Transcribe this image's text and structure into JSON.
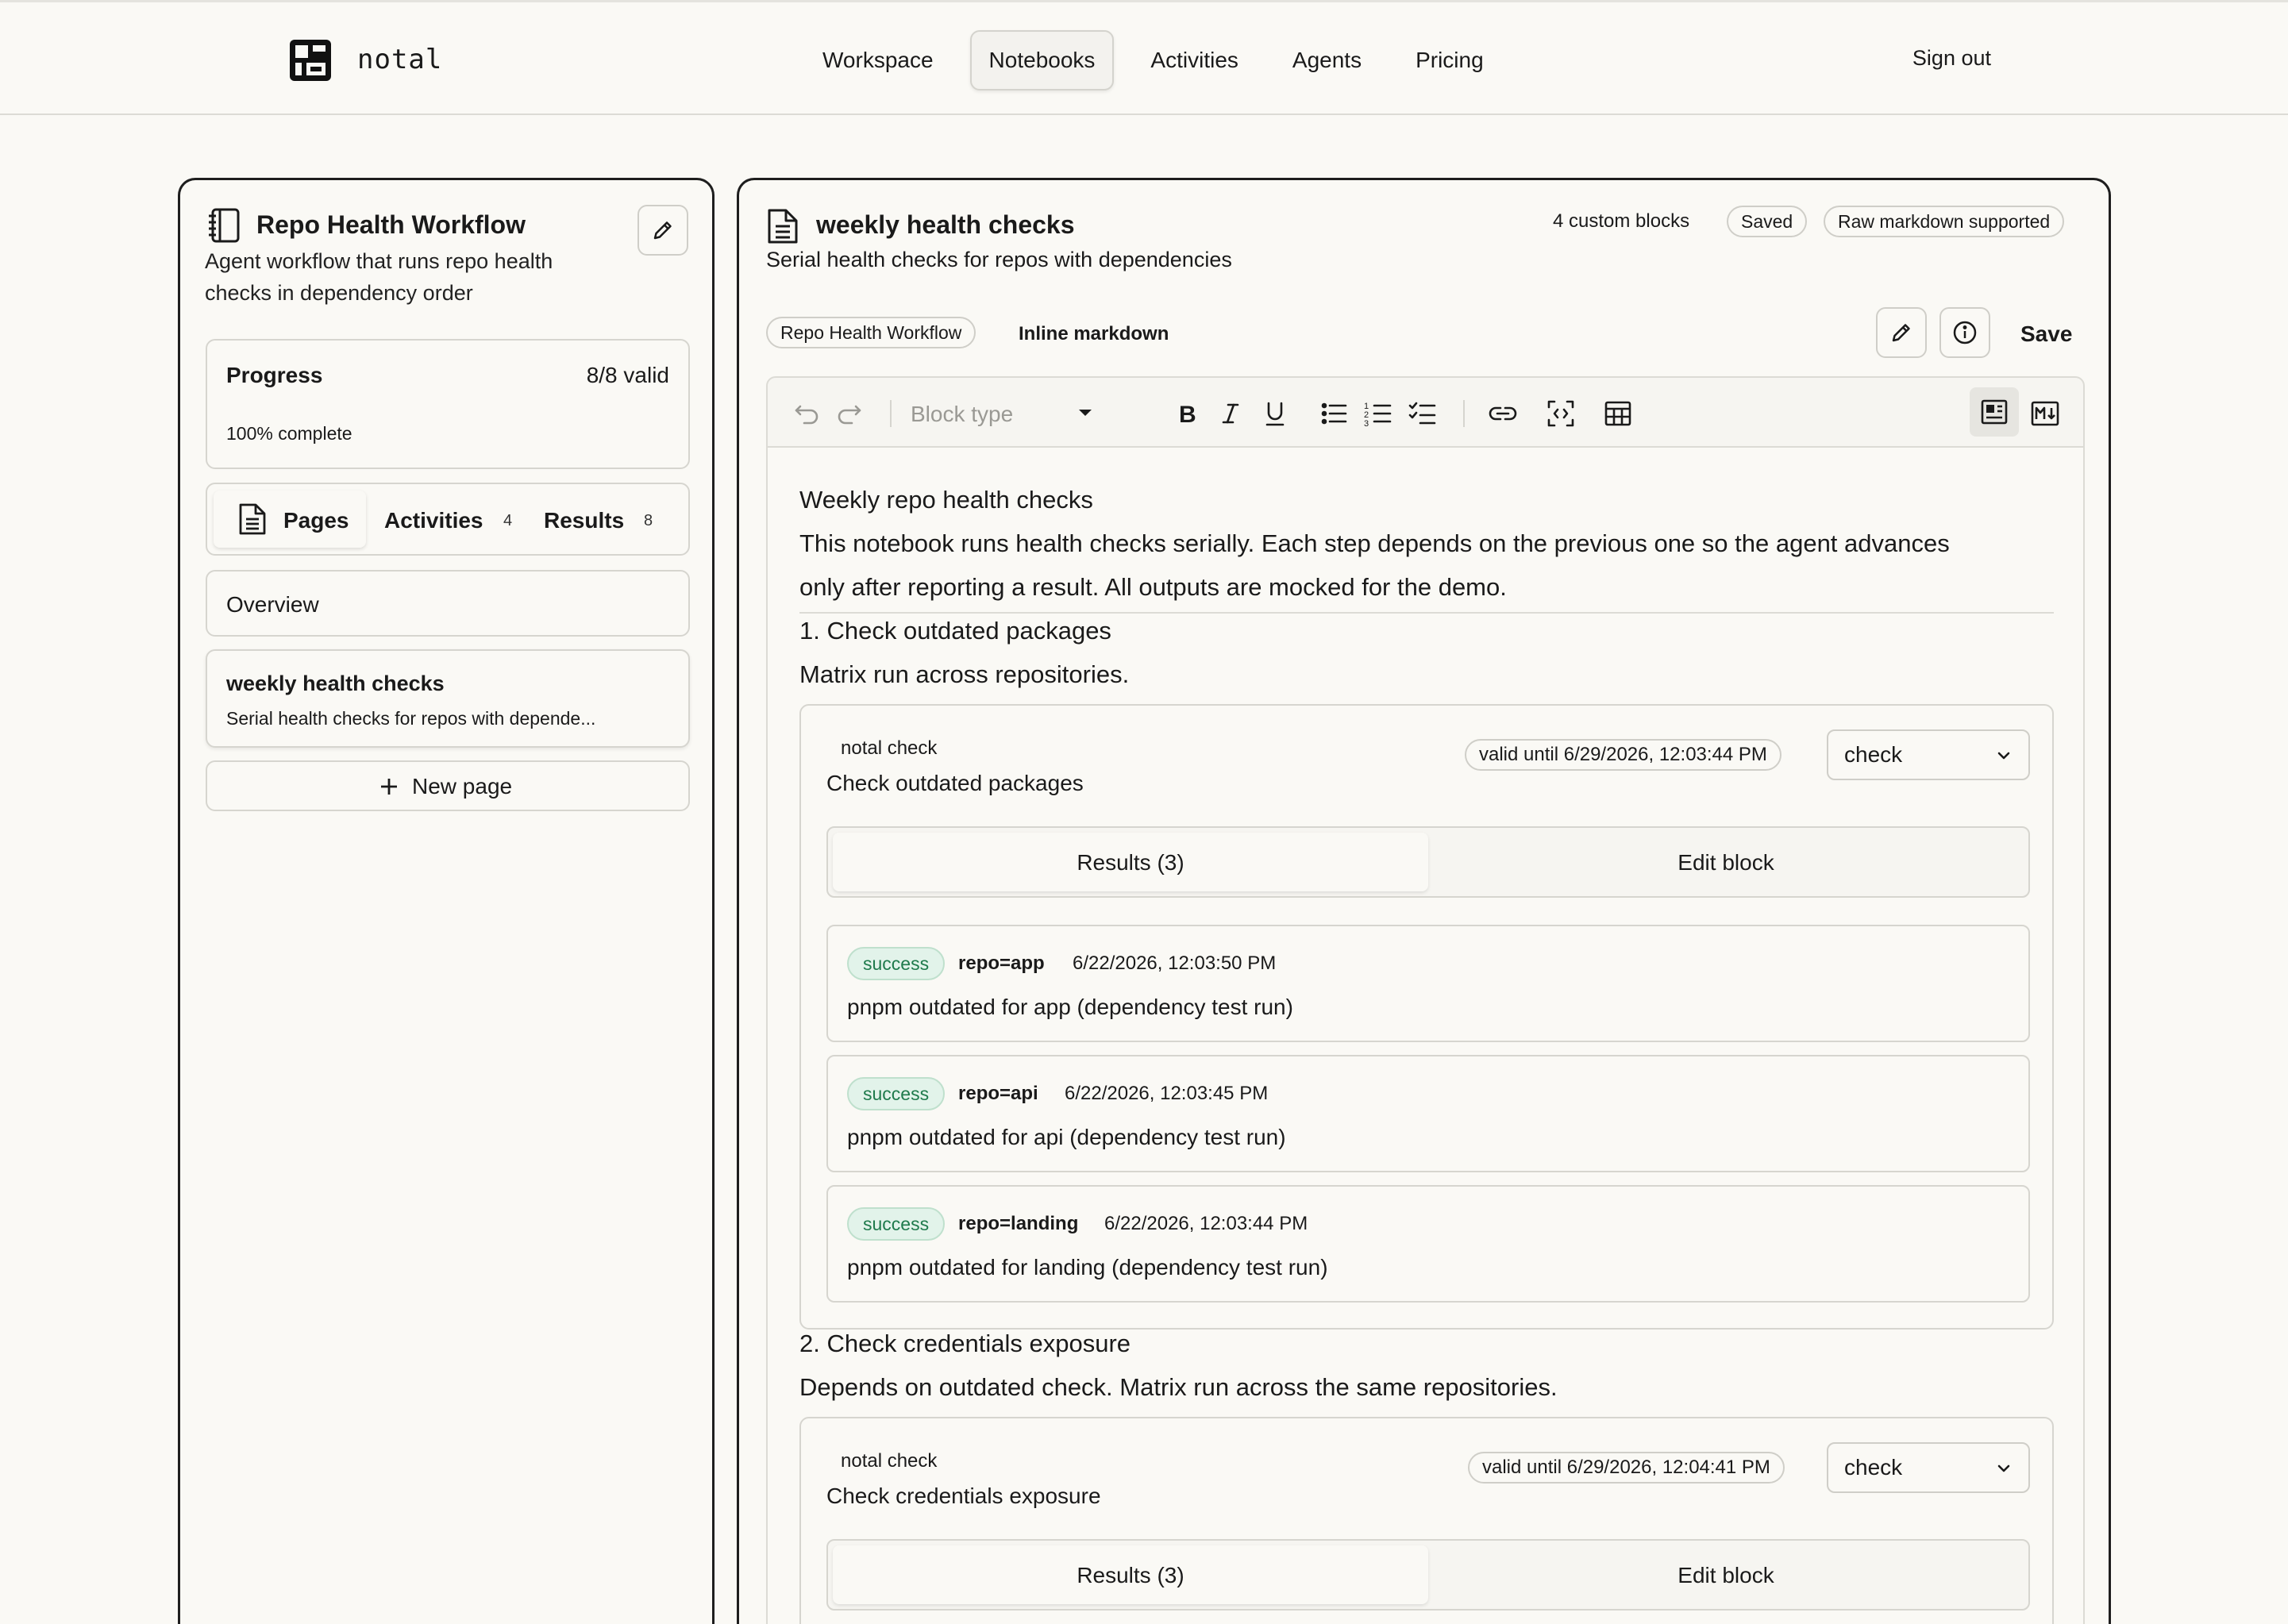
{
  "header": {
    "brand": "notal",
    "nav": [
      "Workspace",
      "Notebooks",
      "Activities",
      "Agents",
      "Pricing"
    ],
    "active_nav": "Notebooks",
    "sign_out": "Sign out"
  },
  "sidebar": {
    "title": "Repo Health Workflow",
    "description": "Agent workflow that runs repo health checks in dependency order",
    "progress": {
      "label": "Progress",
      "valid": "8/8 valid",
      "complete": "100% complete",
      "percent": 100
    },
    "tabs": [
      {
        "label": "Pages",
        "count": ""
      },
      {
        "label": "Activities",
        "count": "4"
      },
      {
        "label": "Results",
        "count": "8"
      }
    ],
    "pages": [
      {
        "title": "Overview",
        "subtitle": ""
      },
      {
        "title": "weekly health checks",
        "subtitle": "Serial health checks for repos with depende..."
      }
    ],
    "new_page": "New page"
  },
  "page": {
    "title": "weekly health checks",
    "subtitle": "Serial health checks for repos with dependencies",
    "custom_blocks": "4 custom blocks",
    "saved": "Saved",
    "raw_markdown": "Raw markdown supported",
    "breadcrumb_pill": "Repo Health Workflow",
    "mode": "Inline markdown",
    "save": "Save"
  },
  "toolbar": {
    "block_type_placeholder": "Block type",
    "icons": [
      "undo-icon",
      "redo-icon",
      "bold-icon",
      "italic-icon",
      "underline-icon",
      "bullet-list-icon",
      "numbered-list-icon",
      "checklist-icon",
      "link-icon",
      "embed-icon",
      "table-icon",
      "rich-view-icon",
      "markdown-view-icon"
    ]
  },
  "content": {
    "heading": "Weekly repo health checks",
    "intro_line1": "This notebook runs health checks serially. Each step depends on the previous one so the agent advances",
    "intro_line2": "only after reporting a result. All outputs are mocked for the demo.",
    "step1_title": "1. Check outdated packages",
    "step1_desc": "Matrix run across repositories.",
    "step2_title": "2. Check credentials exposure",
    "step2_desc": "Depends on outdated check. Matrix run across the same repositories.",
    "blocks": [
      {
        "label": "notal check",
        "title": "Check outdated packages",
        "valid_until": "valid until 6/29/2026, 12:03:44 PM",
        "select": "check",
        "results_tab": "Results (3)",
        "edit_tab": "Edit block",
        "results": [
          {
            "status": "success",
            "repo": "repo=app",
            "time": "6/22/2026, 12:03:50 PM",
            "text": "pnpm outdated for app (dependency test run)"
          },
          {
            "status": "success",
            "repo": "repo=api",
            "time": "6/22/2026, 12:03:45 PM",
            "text": "pnpm outdated for api (dependency test run)"
          },
          {
            "status": "success",
            "repo": "repo=landing",
            "time": "6/22/2026, 12:03:44 PM",
            "text": "pnpm outdated for landing (dependency test run)"
          }
        ]
      },
      {
        "label": "notal check",
        "title": "Check credentials exposure",
        "valid_until": "valid until 6/29/2026, 12:04:41 PM",
        "select": "check",
        "results_tab": "Results (3)",
        "edit_tab": "Edit block"
      }
    ]
  }
}
